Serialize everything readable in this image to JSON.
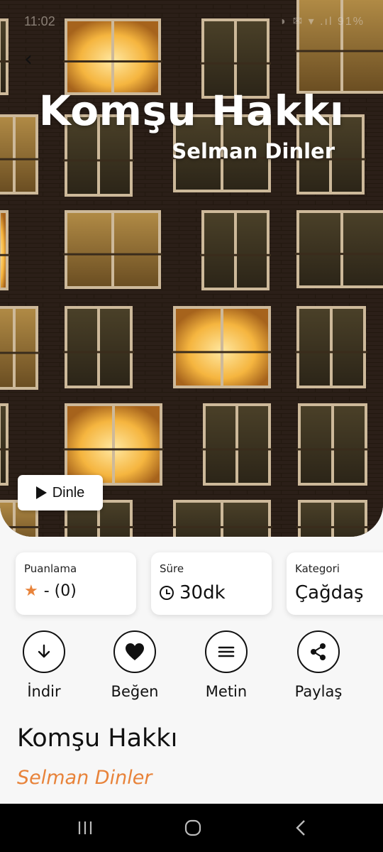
{
  "status_bar": {
    "time": "11:02",
    "icons": "◗ ✉ ▾ .ıl 91%"
  },
  "hero": {
    "title": "Komşu Hakkı",
    "author": "Selman Dinler",
    "play_label": "Dinle",
    "back_icon": "chevron-left-icon"
  },
  "info_cards": [
    {
      "label": "Puanlama",
      "value": "- (0)",
      "icon": "star-icon"
    },
    {
      "label": "Süre",
      "value": "30dk",
      "icon": "clock-icon"
    },
    {
      "label": "Kategori",
      "value": "Çağdaş"
    }
  ],
  "actions": [
    {
      "label": "İndir",
      "icon": "download-icon"
    },
    {
      "label": "Beğen",
      "icon": "heart-icon"
    },
    {
      "label": "Metin",
      "icon": "menu-icon"
    },
    {
      "label": "Paylaş",
      "icon": "share-icon"
    }
  ],
  "book": {
    "title": "Komşu Hakkı",
    "author": "Selman Dinler"
  },
  "colors": {
    "accent": "#e8833a",
    "text": "#111111",
    "background": "#f7f7f7",
    "navbar": "#000000"
  },
  "nav": [
    "recent-apps-icon",
    "home-icon",
    "back-icon"
  ]
}
